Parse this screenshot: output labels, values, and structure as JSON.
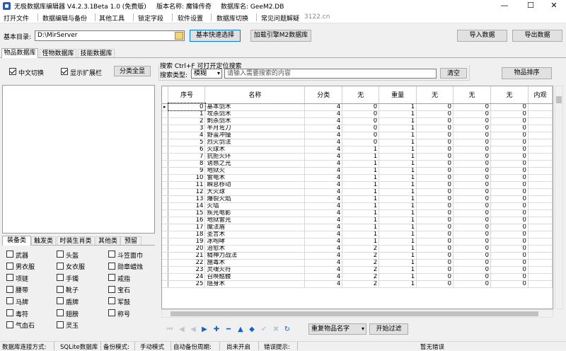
{
  "window": {
    "title": "无极数据库编辑器 V4.2.3.1",
    "edition": "Beta 1.0 (免费版)",
    "version_name": "版本名称: 魔锋传奇",
    "db_name": "数据库名: GeeM2.DB",
    "minimize": "—",
    "maximize": "☐",
    "close": "✕"
  },
  "menu": {
    "items": [
      "打开文件",
      "数据编辑与备份",
      "其他工具",
      "锁定字段",
      "软件设置",
      "数据库切换",
      "常见问题解疑"
    ],
    "site": "3122.cn"
  },
  "toolbar": {
    "dir_label": "基本目录:",
    "dir_value": "D:\\MirServer",
    "quick_select": "基本快速选择",
    "load_m2": "加载引擎M2数据库",
    "import": "导入数据",
    "export": "导出数据"
  },
  "tabs": [
    "物品数据库",
    "怪物数据库",
    "技能数据库"
  ],
  "left_panel": {
    "chinese_toggle": "中文切换",
    "show_ext": "显示扩展栏",
    "show_all": "分类全显",
    "sub_tabs": [
      "装备类",
      "触发类",
      "时装生肖类",
      "其他类",
      "预留"
    ],
    "categories": [
      [
        "武器",
        "头盔",
        "斗笠面巾"
      ],
      [
        "男衣服",
        "女衣服",
        "勋章蜡烛"
      ],
      [
        "项链",
        "手镯",
        "戒指"
      ],
      [
        "腰带",
        "靴子",
        "宝石"
      ],
      [
        "马牌",
        "盾牌",
        "军鼓"
      ],
      [
        "毒符",
        "翅膀",
        "称号"
      ],
      [
        "气血石",
        "灵玉",
        ""
      ]
    ]
  },
  "search": {
    "group_title": "搜索  Ctrl+F 可打开定位搜索",
    "type_label": "搜索类型:",
    "type_value": "模糊",
    "placeholder": "请输入需要搜索的内容",
    "clear": "清空",
    "sort": "物品排序"
  },
  "table": {
    "headers": [
      "序号",
      "名称",
      "分类",
      "无",
      "重量",
      "无",
      "无",
      "无",
      "内观"
    ],
    "rows": [
      [
        "0",
        "基本剑术",
        "4",
        "0",
        "1",
        "0",
        "0",
        "0"
      ],
      [
        "1",
        "攻杀剑术",
        "4",
        "0",
        "1",
        "0",
        "0",
        "0"
      ],
      [
        "2",
        "刺杀剑术",
        "4",
        "0",
        "1",
        "0",
        "0",
        "0"
      ],
      [
        "3",
        "半月弯刀",
        "4",
        "0",
        "1",
        "0",
        "0",
        "0"
      ],
      [
        "4",
        "野蛮冲撞",
        "4",
        "0",
        "1",
        "0",
        "0",
        "0"
      ],
      [
        "5",
        "烈火剑法",
        "4",
        "0",
        "1",
        "0",
        "0",
        "0"
      ],
      [
        "6",
        "火球术",
        "4",
        "1",
        "1",
        "0",
        "0",
        "0"
      ],
      [
        "7",
        "抗拒火环",
        "4",
        "1",
        "1",
        "0",
        "0",
        "0"
      ],
      [
        "8",
        "诱惑之光",
        "4",
        "1",
        "1",
        "0",
        "0",
        "0"
      ],
      [
        "9",
        "地狱火",
        "4",
        "1",
        "1",
        "0",
        "0",
        "0"
      ],
      [
        "10",
        "雷电术",
        "4",
        "1",
        "1",
        "0",
        "0",
        "0"
      ],
      [
        "11",
        "瞬息移动",
        "4",
        "1",
        "1",
        "0",
        "0",
        "0"
      ],
      [
        "12",
        "大火球",
        "4",
        "1",
        "1",
        "0",
        "0",
        "0"
      ],
      [
        "13",
        "爆裂火焰",
        "4",
        "1",
        "1",
        "0",
        "0",
        "0"
      ],
      [
        "14",
        "火墙",
        "4",
        "1",
        "1",
        "0",
        "0",
        "0"
      ],
      [
        "15",
        "疾光电影",
        "4",
        "1",
        "1",
        "0",
        "0",
        "0"
      ],
      [
        "16",
        "地狱雷光",
        "4",
        "1",
        "1",
        "0",
        "0",
        "0"
      ],
      [
        "17",
        "魔法盾",
        "4",
        "1",
        "1",
        "0",
        "0",
        "0"
      ],
      [
        "18",
        "圣言术",
        "4",
        "1",
        "1",
        "0",
        "0",
        "0"
      ],
      [
        "19",
        "冰咆哮",
        "4",
        "1",
        "1",
        "0",
        "0",
        "0"
      ],
      [
        "20",
        "治愈术",
        "4",
        "2",
        "1",
        "0",
        "0",
        "0"
      ],
      [
        "21",
        "精神力战法",
        "4",
        "2",
        "1",
        "0",
        "0",
        "0"
      ],
      [
        "22",
        "施毒术",
        "4",
        "2",
        "1",
        "0",
        "0",
        "0"
      ],
      [
        "23",
        "灵魂火符",
        "4",
        "2",
        "1",
        "0",
        "0",
        "0"
      ],
      [
        "24",
        "召唤骷髅",
        "4",
        "2",
        "1",
        "0",
        "0",
        "0"
      ],
      [
        "25",
        "隐身术",
        "4",
        "2",
        "1",
        "0",
        "0",
        "0"
      ]
    ]
  },
  "bottom": {
    "dup_select": "重复物品名字",
    "start_filter": "开始过滤"
  },
  "status": {
    "conn_label": "数据库连接方式:",
    "conn_value": "SQLite数据库",
    "backup_label": "备份模式:",
    "backup_value": "手动模式",
    "auto_label": "自动备份周期:",
    "auto_value": "尚未开启",
    "err_label": "错误提示:",
    "err_value": "暂无错误"
  }
}
